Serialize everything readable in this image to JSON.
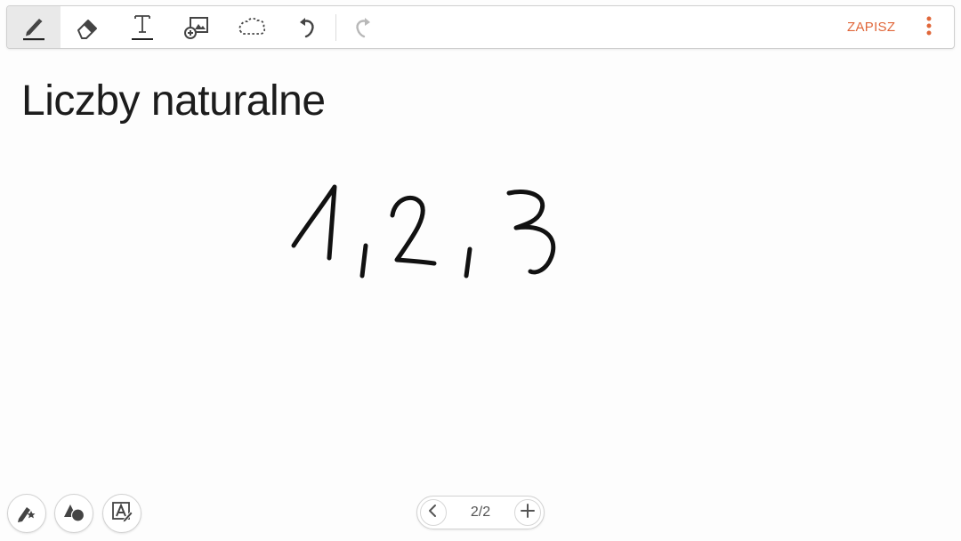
{
  "toolbar": {
    "tools": [
      {
        "name": "pen",
        "icon": "pen-icon",
        "active": true
      },
      {
        "name": "eraser",
        "icon": "eraser-icon",
        "active": false
      },
      {
        "name": "text",
        "icon": "text-icon",
        "active": false
      },
      {
        "name": "insert-image",
        "icon": "add-image-icon",
        "active": false
      },
      {
        "name": "lasso-select",
        "icon": "lasso-icon",
        "active": false
      },
      {
        "name": "undo",
        "icon": "undo-icon",
        "active": false
      },
      {
        "name": "redo",
        "icon": "redo-icon",
        "active": false,
        "disabled": true
      }
    ],
    "save_label": "ZAPISZ",
    "more_icon": "more-vertical-icon"
  },
  "note": {
    "title": "Liczby naturalne",
    "handwriting_text": "1,2,3"
  },
  "bottom_tools": [
    {
      "name": "pen-favorites",
      "icon": "pen-star-icon"
    },
    {
      "name": "shapes",
      "icon": "shapes-icon"
    },
    {
      "name": "handwriting-to-text",
      "icon": "text-convert-icon"
    }
  ],
  "pager": {
    "label": "2/2",
    "prev_icon": "chevron-left-icon",
    "add_icon": "plus-icon"
  },
  "colors": {
    "accent": "#e0673a",
    "ink": "#111111",
    "icon": "#444444",
    "icon_disabled": "#b8b8b8",
    "active_tool_bg": "#e9e9e9"
  }
}
